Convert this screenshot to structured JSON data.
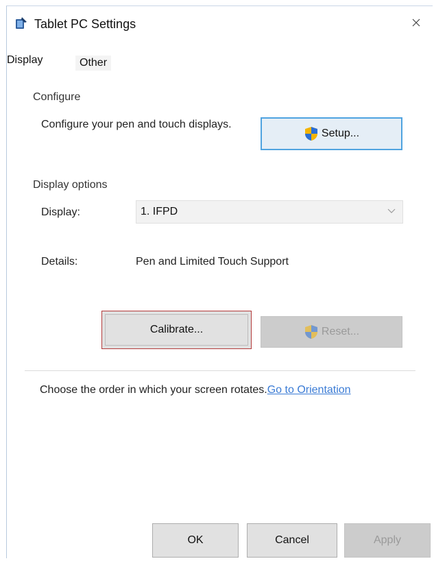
{
  "window": {
    "title": "Tablet PC Settings"
  },
  "tabs": [
    {
      "label": "Display",
      "selected": true
    },
    {
      "label": "Other",
      "selected": false
    }
  ],
  "configure": {
    "heading": "Configure",
    "description": "Configure your pen and touch displays.",
    "setup_label": "Setup..."
  },
  "display_options": {
    "heading": "Display options",
    "display_label": "Display:",
    "display_value": "1. IFPD",
    "details_label": "Details:",
    "details_value": "Pen and Limited Touch Support",
    "calibrate_label": "Calibrate...",
    "reset_label": "Reset..."
  },
  "orientation": {
    "text": "Choose the order in which your screen rotates.",
    "link": "Go to Orientation"
  },
  "footer": {
    "ok": "OK",
    "cancel": "Cancel",
    "apply": "Apply"
  },
  "colors": {
    "link": "#3a7bd5",
    "focus_border": "#4fa3e0",
    "highlight_border": "#b33a3a"
  },
  "icons": {
    "app": "tablet-pc-icon",
    "uac": "uac-shield-icon",
    "close": "close-icon",
    "chevron": "chevron-down-icon"
  }
}
